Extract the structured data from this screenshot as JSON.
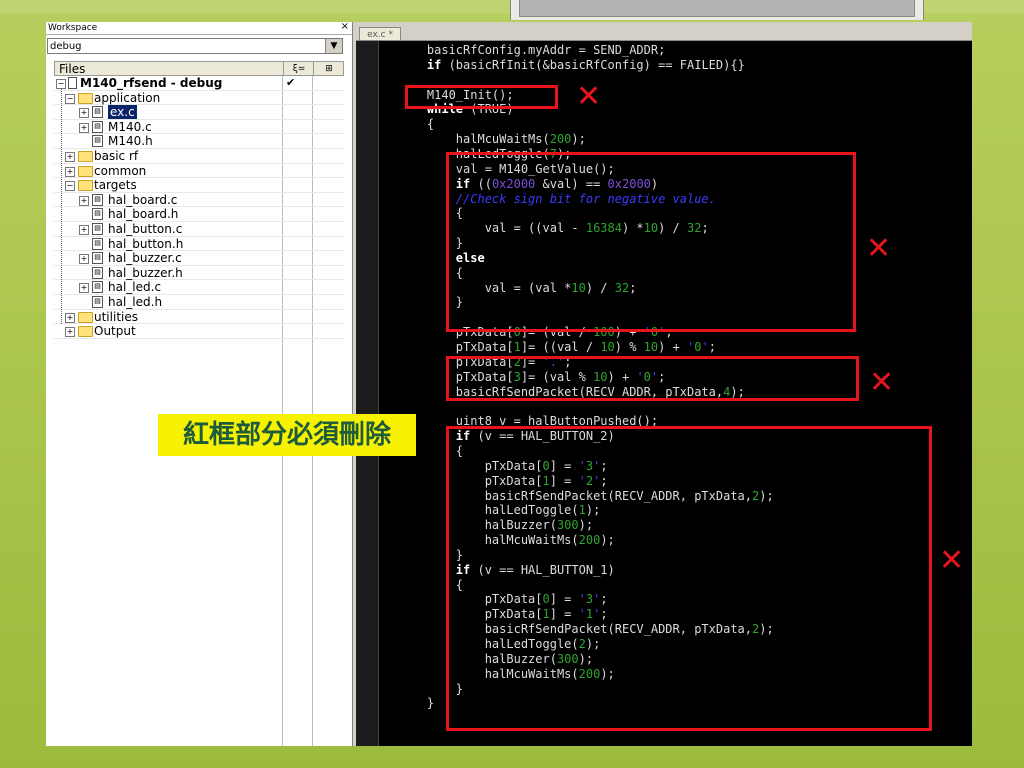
{
  "workspace": {
    "title": "Workspace",
    "close": "×",
    "config_value": "debug",
    "files_header": "Files",
    "col1_icon": "ξ=",
    "col2_icon": "⊞",
    "project": "M140_rfsend - debug",
    "project_check": "✔",
    "tree": [
      {
        "label": "application",
        "type": "folder",
        "expander": "−"
      },
      {
        "label": "ex.c",
        "type": "file",
        "expander": "+",
        "selected": true
      },
      {
        "label": "M140.c",
        "type": "file",
        "expander": "+"
      },
      {
        "label": "M140.h",
        "type": "file",
        "expander": ""
      },
      {
        "label": "basic rf",
        "type": "folder",
        "expander": "+"
      },
      {
        "label": "common",
        "type": "folder",
        "expander": "+"
      },
      {
        "label": "targets",
        "type": "folder",
        "expander": "−"
      },
      {
        "label": "hal_board.c",
        "type": "file",
        "expander": "+"
      },
      {
        "label": "hal_board.h",
        "type": "file",
        "expander": ""
      },
      {
        "label": "hal_button.c",
        "type": "file",
        "expander": "+"
      },
      {
        "label": "hal_button.h",
        "type": "file",
        "expander": ""
      },
      {
        "label": "hal_buzzer.c",
        "type": "file",
        "expander": "+"
      },
      {
        "label": "hal_buzzer.h",
        "type": "file",
        "expander": ""
      },
      {
        "label": "hal_led.c",
        "type": "file",
        "expander": "+"
      },
      {
        "label": "hal_led.h",
        "type": "file",
        "expander": ""
      },
      {
        "label": "utilities",
        "type": "folder",
        "expander": "+"
      },
      {
        "label": "Output",
        "type": "folder",
        "expander": "+"
      }
    ]
  },
  "editor": {
    "tab_label": "ex.c *",
    "lines": [
      "    basicRfConfig.myAddr = SEND_ADDR;",
      "    if (basicRfInit(&basicRfConfig) == FAILED){}",
      "",
      "    M140_Init();",
      "    while (TRUE)",
      "    {",
      "        halMcuWaitMs(200);",
      "        halLedToggle(7);",
      "        val = M140_GetValue();",
      "        if ((0x2000 &val) == 0x2000)",
      "        //Check sign bit for negative value.",
      "        {",
      "            val = ((val - 16384) *10) / 32;",
      "        }",
      "        else",
      "        {",
      "            val = (val *10) / 32;",
      "        }",
      "",
      "        pTxData[0]= (val / 100) + '0';",
      "        pTxData[1]= ((val / 10) % 10) + '0';",
      "        pTxData[2]= '.';",
      "        pTxData[3]= (val % 10) + '0';",
      "        basicRfSendPacket(RECV_ADDR, pTxData,4);",
      "",
      "        uint8 v = halButtonPushed();",
      "        if (v == HAL_BUTTON_2)",
      "        {",
      "            pTxData[0] = '3';",
      "            pTxData[1] = '2';",
      "            basicRfSendPacket(RECV_ADDR, pTxData,2);",
      "            halLedToggle(1);",
      "            halBuzzer(300);",
      "            halMcuWaitMs(200);",
      "        }",
      "        if (v == HAL_BUTTON_1)",
      "        {",
      "            pTxData[0] = '3';",
      "            pTxData[1] = '1';",
      "            basicRfSendPacket(RECV_ADDR, pTxData,2);",
      "            halLedToggle(2);",
      "            halBuzzer(300);",
      "            halMcuWaitMs(200);",
      "        }",
      "    }"
    ]
  },
  "annotation": {
    "note": "紅框部分必須刪除",
    "mark": "✕",
    "color": "#e8141b",
    "note_bg": "#f6f200"
  }
}
